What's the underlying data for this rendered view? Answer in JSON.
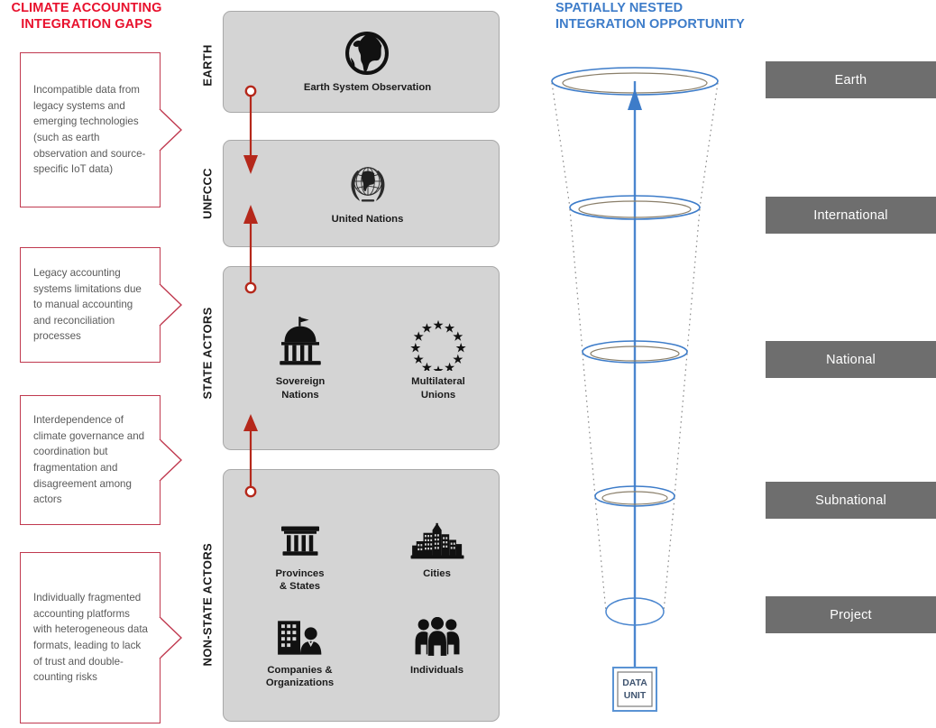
{
  "left": {
    "title": "CLIMATE ACCOUNTING\nINTEGRATION GAPS",
    "title_line1": "CLIMATE ACCOUNTING",
    "title_line2": "INTEGRATION GAPS",
    "callouts": [
      {
        "text": "Incompatible data from legacy systems and emerging technologies (such as earth observation and source-specific IoT data)"
      },
      {
        "text": "Legacy accounting systems limitations due to manual accounting and reconciliation processes"
      },
      {
        "text": "Interdependence of climate governance and coordination but fragmentation and disagreement among actors"
      },
      {
        "text": "Individually fragmented accounting platforms with heterogeneous data formats, leading to lack of trust and double-counting risks"
      }
    ]
  },
  "center": {
    "panels": [
      {
        "side_label": "EARTH",
        "items": [
          {
            "label": "Earth System Observation",
            "icon": "globe-icon"
          }
        ]
      },
      {
        "side_label": "UNFCCC",
        "items": [
          {
            "label": "United Nations",
            "icon": "united-nations-emblem-icon"
          }
        ]
      },
      {
        "side_label": "STATE ACTORS",
        "items": [
          {
            "label": "Sovereign\nNations",
            "label_line1": "Sovereign",
            "label_line2": "Nations",
            "icon": "capitol-building-icon"
          },
          {
            "label": "Multilateral\nUnions",
            "label_line1": "Multilateral",
            "label_line2": "Unions",
            "icon": "eu-stars-circle-icon"
          }
        ]
      },
      {
        "side_label": "NON-STATE ACTORS",
        "items": [
          {
            "label": "Provinces\n& States",
            "label_line1": "Provinces",
            "label_line2": "& States",
            "icon": "classical-building-icon"
          },
          {
            "label": "Cities",
            "label_line1": "Cities",
            "label_line2": "",
            "icon": "city-skyline-icon"
          },
          {
            "label": "Companies &\nOrganizations",
            "label_line1": "Companies &",
            "label_line2": "Organizations",
            "icon": "office-building-person-icon"
          },
          {
            "label": "Individuals",
            "label_line1": "Individuals",
            "label_line2": "",
            "icon": "three-people-icon"
          }
        ]
      }
    ],
    "arrow_color": "#b5281b"
  },
  "right": {
    "title_line1": "SPATIALLY NESTED",
    "title_line2": "INTEGRATION OPPORTUNITY",
    "levels": [
      {
        "label": "Earth"
      },
      {
        "label": "International"
      },
      {
        "label": "National"
      },
      {
        "label": "Subnational"
      },
      {
        "label": "Project"
      }
    ],
    "data_unit": {
      "line1": "DATA",
      "line2": "UNIT"
    },
    "accent_color": "#3d7cc9",
    "box_color": "#6e6e6e"
  }
}
